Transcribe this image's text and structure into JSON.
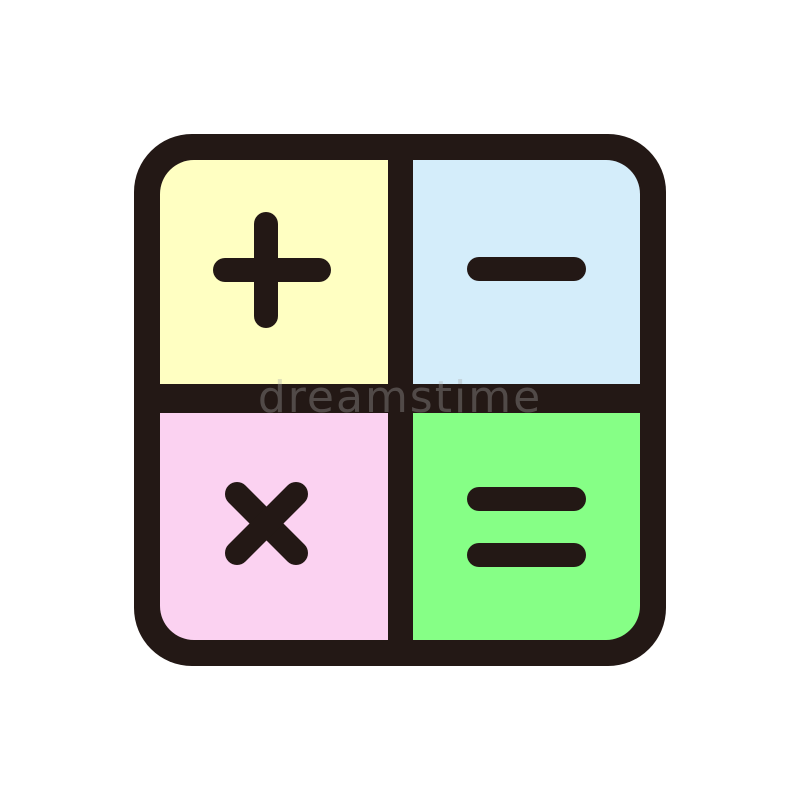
{
  "icon": {
    "name": "calculator-icon",
    "outline_color": "#231815",
    "cells": [
      {
        "name": "plus",
        "color": "#FFFFC2"
      },
      {
        "name": "minus",
        "color": "#D4EDFA"
      },
      {
        "name": "times",
        "color": "#FBD2F1"
      },
      {
        "name": "equals",
        "color": "#86FF86"
      }
    ]
  },
  "watermark": "dreamstime"
}
